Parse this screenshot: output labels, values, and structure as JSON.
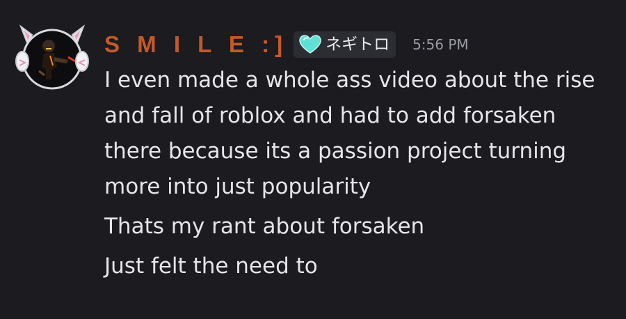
{
  "message": {
    "author": {
      "username": "S M I L E :]",
      "role_tag": {
        "icon": "teal-heart-icon",
        "name": "ネギトロ",
        "color": "#5ee0d6"
      },
      "username_color": "#c55a26",
      "avatar": "cat-ear-headphones-avatar"
    },
    "timestamp": "5:56 PM",
    "paragraphs": [
      {
        "lines": [
          "I even made a whole ass video about the rise",
          "and fall of roblox and had to add forsaken",
          "there because its a passion project turning",
          "more into just popularity"
        ]
      },
      {
        "lines": [
          "Thats my rant about forsaken"
        ]
      },
      {
        "lines": [
          "Just felt the need to"
        ]
      }
    ]
  },
  "theme": {
    "background": "#1b1b20",
    "text": "#e6e6ea",
    "muted": "#9b9ca4",
    "tag_bg": "#2c2d33"
  }
}
